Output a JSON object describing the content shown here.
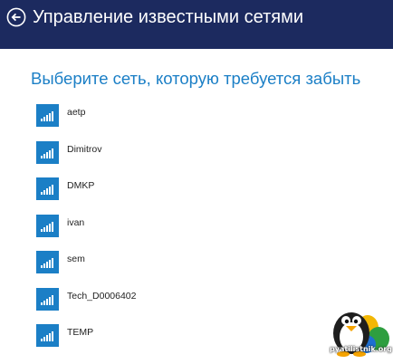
{
  "header": {
    "title": "Управление известными сетями",
    "background": "#1c2a5f"
  },
  "subtitle": "Выберите сеть, которую требуется забыть",
  "accent_color": "#1b7fc6",
  "networks": [
    {
      "name": "aetp",
      "icon": "wifi-signal-icon"
    },
    {
      "name": "Dimitrov",
      "icon": "wifi-signal-icon"
    },
    {
      "name": "DMKP",
      "icon": "wifi-signal-icon"
    },
    {
      "name": "ivan",
      "icon": "wifi-signal-icon"
    },
    {
      "name": "sem",
      "icon": "wifi-signal-icon"
    },
    {
      "name": "Tech_D0006402",
      "icon": "wifi-signal-icon"
    },
    {
      "name": "TEMP",
      "icon": "wifi-signal-icon"
    }
  ],
  "watermark": {
    "text": "pyatilistnik.org",
    "icon": "penguin-logo-icon"
  }
}
